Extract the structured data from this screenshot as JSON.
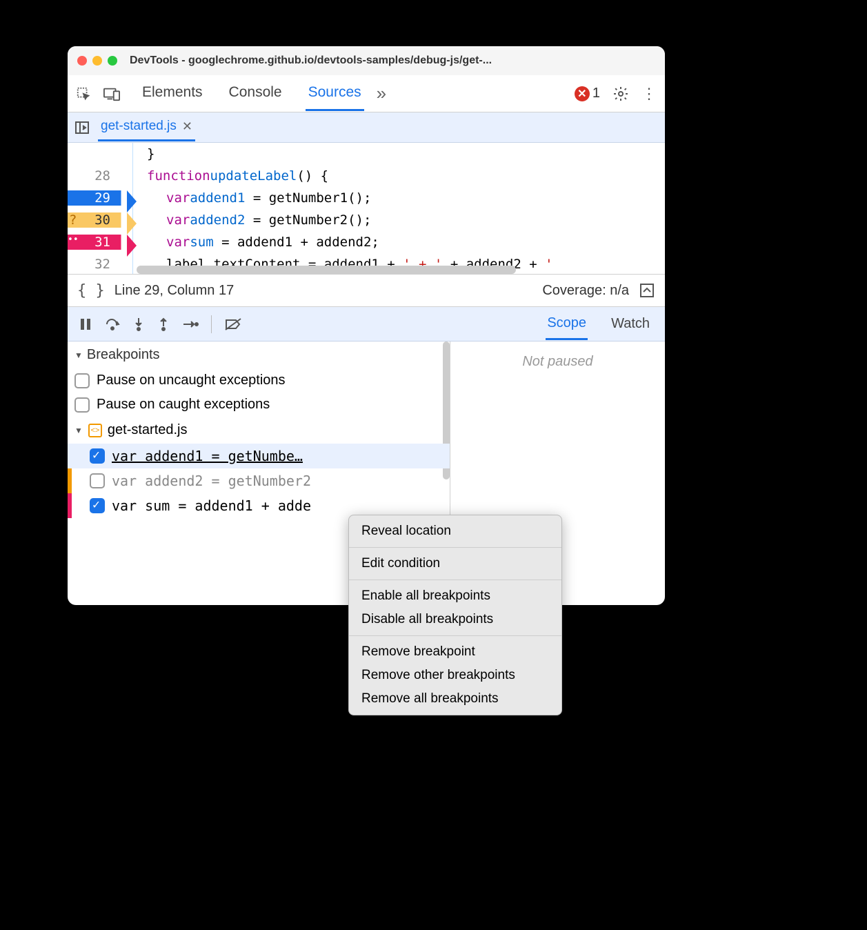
{
  "window": {
    "title": "DevTools - googlechrome.github.io/devtools-samples/debug-js/get-..."
  },
  "toolbar": {
    "tabs": [
      "Elements",
      "Console",
      "Sources"
    ],
    "active_tab": "Sources",
    "error_count": "1"
  },
  "filetab": {
    "name": "get-started.js"
  },
  "code": {
    "lines": [
      {
        "num": "28",
        "bp": "",
        "html": "<span class='kw'>function</span> <span class='fn'>updateLabel</span>() {"
      },
      {
        "num": "29",
        "bp": "blue",
        "html": "<span class='kw'>var</span> <span class='var'>addend1</span> = getNumber1();"
      },
      {
        "num": "30",
        "bp": "orange",
        "html": "<span class='kw'>var</span> <span class='var'>addend2</span> = getNumber2();"
      },
      {
        "num": "31",
        "bp": "pink",
        "html": "<span class='kw'>var</span> <span class='var'>sum</span> = addend1 + addend2;"
      },
      {
        "num": "32",
        "bp": "",
        "html": "label.textContent = addend1 + <span class='str'>' + '</span> + addend2 + <span class='str'>'</span>"
      }
    ]
  },
  "statusbar": {
    "position": "Line 29, Column 17",
    "coverage": "Coverage: n/a"
  },
  "debug_tabs": {
    "scope": "Scope",
    "watch": "Watch"
  },
  "scope_panel": {
    "not_paused": "Not paused"
  },
  "breakpoints": {
    "header": "Breakpoints",
    "pause_uncaught": "Pause on uncaught exceptions",
    "pause_caught": "Pause on caught exceptions",
    "file": "get-started.js",
    "items": [
      {
        "checked": true,
        "marker": "",
        "selected": true,
        "text": "var addend1 = getNumbe…"
      },
      {
        "checked": false,
        "marker": "#f29900",
        "selected": false,
        "text": "var addend2 = getNumber2"
      },
      {
        "checked": true,
        "marker": "#e91e63",
        "selected": false,
        "text": "var sum = addend1 + adde"
      }
    ]
  },
  "context_menu": {
    "groups": [
      [
        "Reveal location"
      ],
      [
        "Edit condition"
      ],
      [
        "Enable all breakpoints",
        "Disable all breakpoints"
      ],
      [
        "Remove breakpoint",
        "Remove other breakpoints",
        "Remove all breakpoints"
      ]
    ]
  }
}
